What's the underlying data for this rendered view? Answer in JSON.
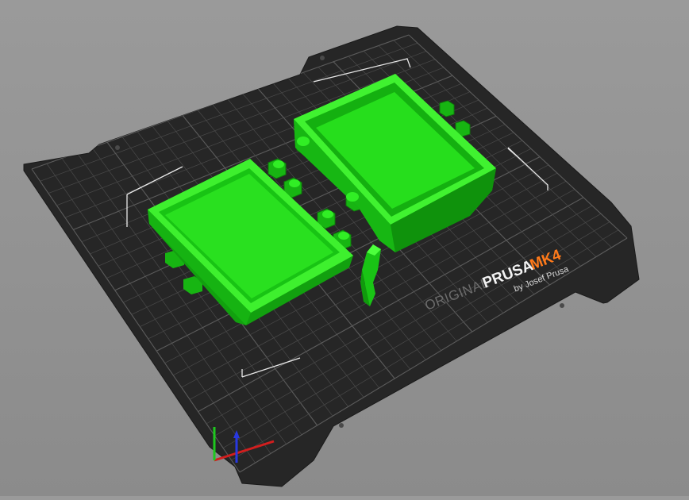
{
  "viewport": {
    "name": "3D plater view",
    "bed_logo": {
      "original": "ORIGINAL",
      "brand": "PRUSA",
      "model": "MK4",
      "byline": "by Josef Prusa"
    },
    "colors": {
      "background": "#8b8b8b",
      "bed_sheet": "#262626",
      "grid_line": "#4a4a4a",
      "grid_major": "#5c5c5c",
      "model_green": "#22e01a",
      "model_green_dark": "#14a810",
      "model_green_light": "#5cff4a",
      "model_model_accent": "#ff7a1a",
      "axis_x": "#d21e1e",
      "axis_y": "#1ec81e",
      "axis_z": "#2838e0"
    },
    "objects": [
      {
        "name": "box-lid"
      },
      {
        "name": "box-body"
      },
      {
        "name": "hinge-pin"
      }
    ]
  }
}
